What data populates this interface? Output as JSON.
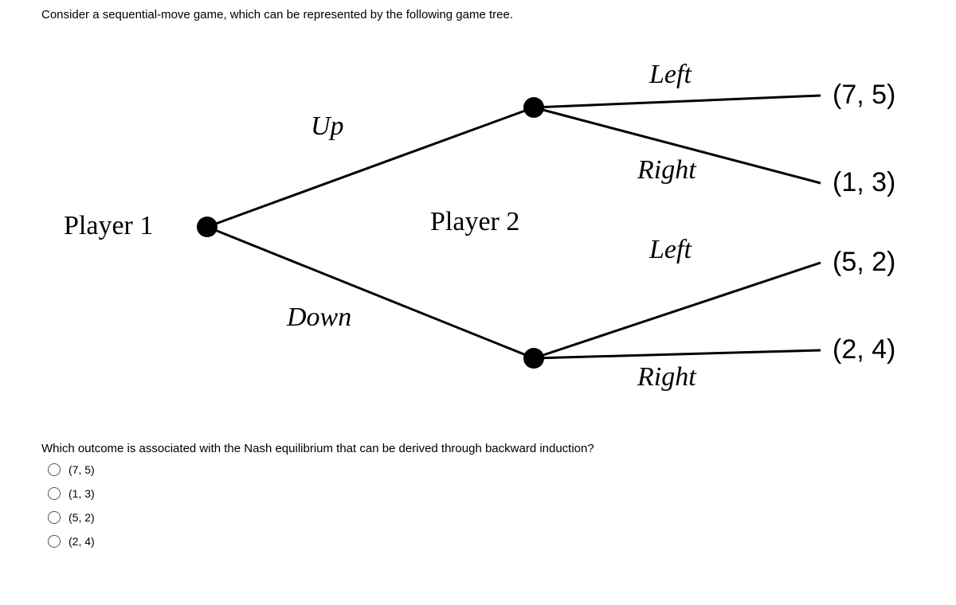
{
  "intro": "Consider a sequential-move game, which can be represented by the following game tree.",
  "players": {
    "p1": "Player 1",
    "p2": "Player 2"
  },
  "moves": {
    "up": "Up",
    "down": "Down",
    "left_top": "Left",
    "right_top": "Right",
    "left_bot": "Left",
    "right_bot": "Right"
  },
  "payoffs": {
    "p00": "(7, 5)",
    "p01": "(1, 3)",
    "p10": "(5, 2)",
    "p11": "(2, 4)"
  },
  "question": "Which outcome is associated with the Nash equilibrium that can be derived through backward induction?",
  "options": {
    "a": "(7, 5)",
    "b": "(1, 3)",
    "c": "(5, 2)",
    "d": "(2, 4)"
  },
  "chart_data": {
    "type": "tree",
    "title": "Sequential-move game tree",
    "root": {
      "player": "Player 1",
      "branches": [
        {
          "move": "Up",
          "node": {
            "player": "Player 2",
            "branches": [
              {
                "move": "Left",
                "payoff": [
                  7,
                  5
                ]
              },
              {
                "move": "Right",
                "payoff": [
                  1,
                  3
                ]
              }
            ]
          }
        },
        {
          "move": "Down",
          "node": {
            "player": "Player 2",
            "branches": [
              {
                "move": "Left",
                "payoff": [
                  5,
                  2
                ]
              },
              {
                "move": "Right",
                "payoff": [
                  2,
                  4
                ]
              }
            ]
          }
        }
      ]
    }
  }
}
